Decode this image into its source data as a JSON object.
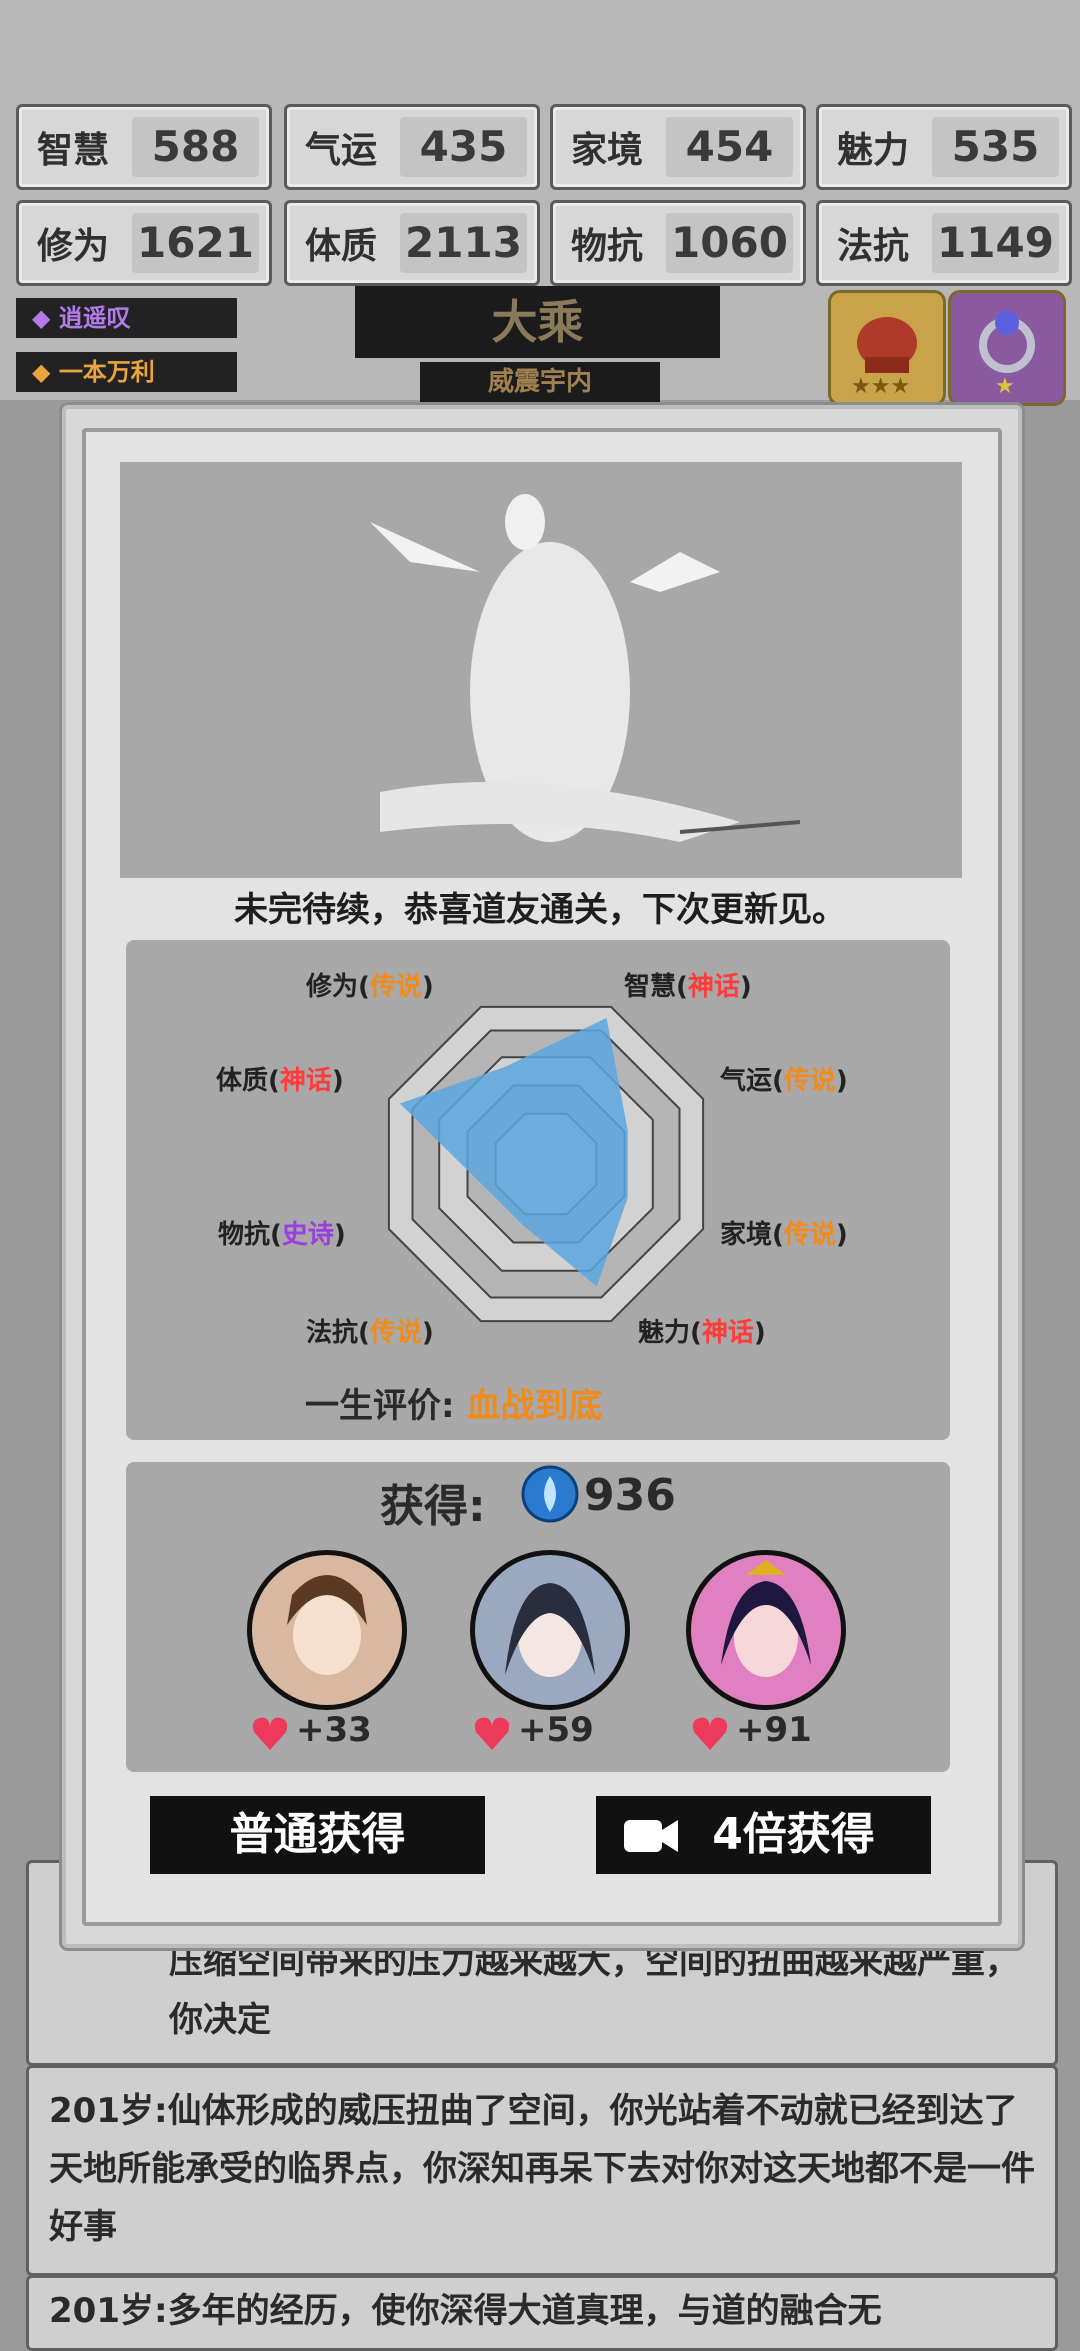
{
  "stats": [
    {
      "label": "智慧",
      "value": "588"
    },
    {
      "label": "气运",
      "value": "435"
    },
    {
      "label": "家境",
      "value": "454"
    },
    {
      "label": "魅力",
      "value": "535"
    },
    {
      "label": "修为",
      "value": "1621"
    },
    {
      "label": "体质",
      "value": "2113"
    },
    {
      "label": "物抗",
      "value": "1060"
    },
    {
      "label": "法抗",
      "value": "1149"
    }
  ],
  "tags": [
    "逍遥叹",
    "一本万利"
  ],
  "realm": {
    "title": "大乘",
    "subtitle": "威震宇内"
  },
  "modal": {
    "headline": "未完待续，恭喜道友通关，下次更新见。",
    "radar_labels": [
      {
        "name": "修为",
        "grade": "传说"
      },
      {
        "name": "智慧",
        "grade": "神话"
      },
      {
        "name": "气运",
        "grade": "传说"
      },
      {
        "name": "家境",
        "grade": "传说"
      },
      {
        "name": "魅力",
        "grade": "神话"
      },
      {
        "name": "法抗",
        "grade": "传说"
      },
      {
        "name": "物抗",
        "grade": "史诗"
      },
      {
        "name": "体质",
        "grade": "神话"
      }
    ],
    "eval_label": "一生评价:",
    "eval_value": "血战到底",
    "gain_label": "获得:",
    "gain_value": "936",
    "favors": [
      "+33",
      "+59",
      "+91"
    ],
    "btn_normal": "普通获得",
    "btn_video": "4倍获得"
  },
  "log": [
    {
      "age": "",
      "text": "压缩空间带来的压力越来越大，空间的扭曲越来越严重，你决定"
    },
    {
      "age": "201岁:",
      "text": "仙体形成的威压扭曲了空间，你光站着不动就已经到达了天地所能承受的临界点，你深知再呆下去对你对这天地都不是一件好事"
    },
    {
      "age": "201岁:",
      "text": "多年的经历，使你深得大道真理，与道的融合无"
    }
  ],
  "radar_levels": [
    0.62,
    0.93,
    0.52,
    0.52,
    0.78,
    0.38,
    0.38,
    0.93
  ],
  "colors": {
    "legend": "#f08a1c",
    "myth": "#ff3b3b",
    "epic": "#9a3ee0",
    "radar": "#5aa7e0"
  }
}
